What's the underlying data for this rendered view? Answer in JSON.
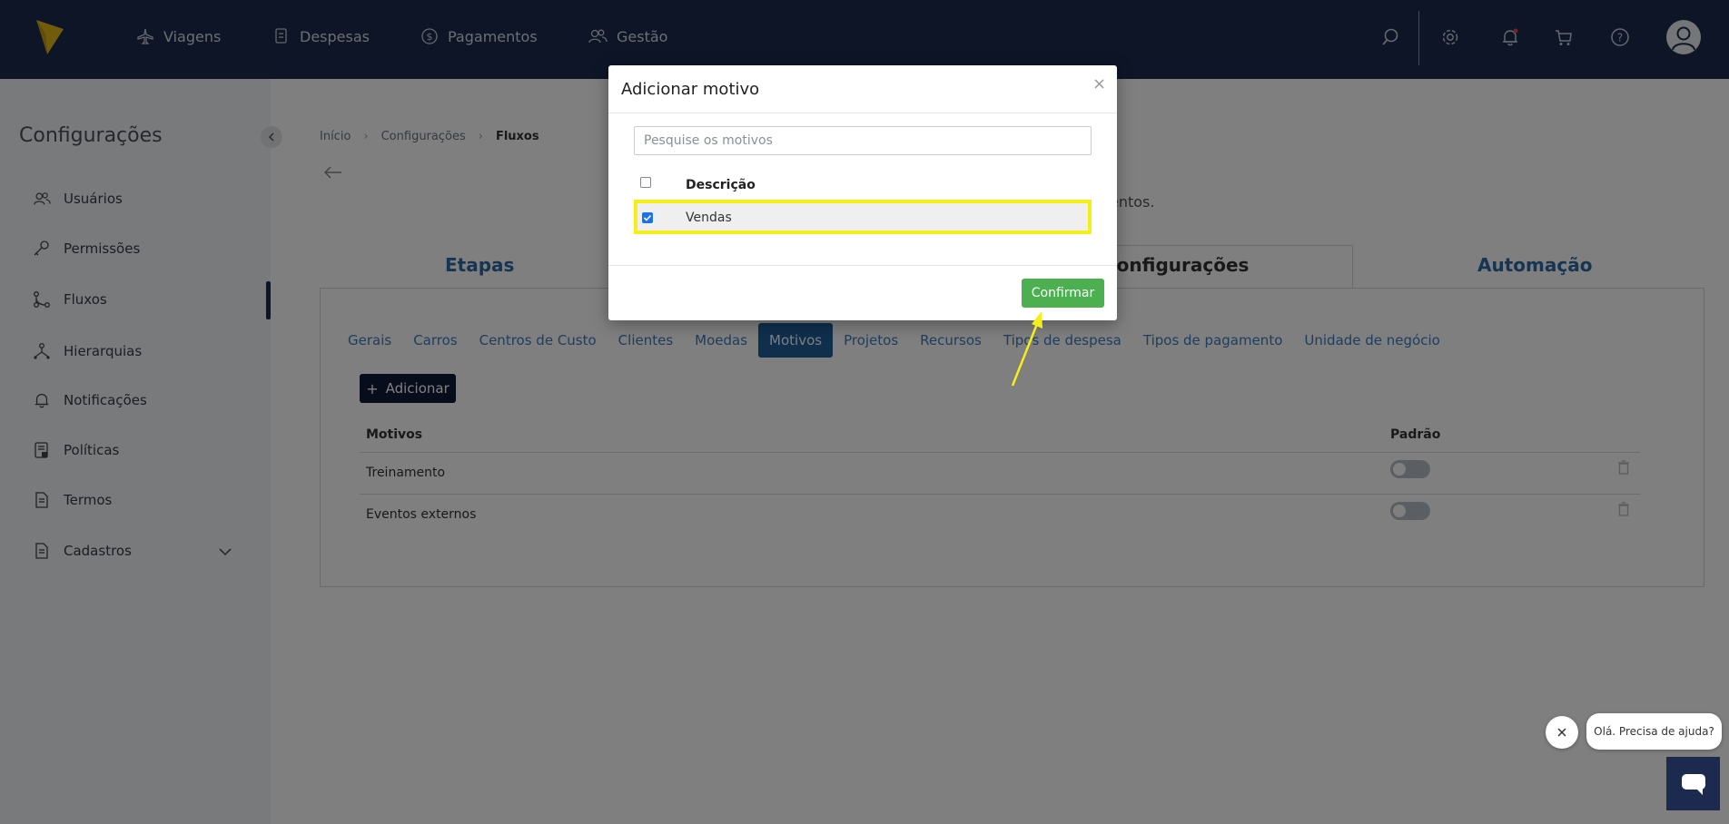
{
  "nav": {
    "items": [
      {
        "label": "Viagens",
        "icon": "plane-icon"
      },
      {
        "label": "Despesas",
        "icon": "receipt-icon"
      },
      {
        "label": "Pagamentos",
        "icon": "dollar-icon"
      },
      {
        "label": "Gestão",
        "icon": "users-icon"
      }
    ],
    "right_icons": [
      "search-icon",
      "gear-icon",
      "bell-icon",
      "cart-icon",
      "help-icon",
      "user-avatar-icon"
    ]
  },
  "sidebar": {
    "title": "Configurações",
    "items": [
      {
        "label": "Usuários",
        "icon": "users-icon"
      },
      {
        "label": "Permissões",
        "icon": "key-icon"
      },
      {
        "label": "Fluxos",
        "icon": "flow-icon"
      },
      {
        "label": "Hierarquias",
        "icon": "hierarchy-icon"
      },
      {
        "label": "Notificações",
        "icon": "bell-icon"
      },
      {
        "label": "Políticas",
        "icon": "policy-icon"
      },
      {
        "label": "Termos",
        "icon": "document-icon"
      },
      {
        "label": "Cadastros",
        "icon": "document-icon"
      }
    ]
  },
  "breadcrumb": {
    "items": [
      "Início",
      "Configurações",
      "Fluxos"
    ]
  },
  "subtitle_fragment": "entos.",
  "main_tabs": [
    "Etapas",
    "Configurações",
    "Automação"
  ],
  "sub_tabs": [
    "Gerais",
    "Carros",
    "Centros de Custo",
    "Clientes",
    "Moedas",
    "Motivos",
    "Projetos",
    "Recursos",
    "Tipos de despesa",
    "Tipos de pagamento",
    "Unidade de negócio"
  ],
  "add_button": "Adicionar",
  "table": {
    "headers": [
      "Motivos",
      "Padrão"
    ],
    "rows": [
      {
        "motivo": "Treinamento"
      },
      {
        "motivo": "Eventos externos"
      }
    ]
  },
  "modal": {
    "title": "Adicionar motivo",
    "close": "×",
    "search_placeholder": "Pesquise os motivos",
    "column_header": "Descrição",
    "rows": [
      {
        "label": "Vendas",
        "checked": true
      }
    ],
    "confirm": "Confirmar"
  },
  "chat": {
    "bubble": "Olá. Precisa de ajuda?"
  },
  "colors": {
    "navy": "#1b2a4e",
    "link_blue": "#3a7dbe",
    "active_tab": "#1f5e9a",
    "confirm_green": "#4caf50",
    "highlight_yellow": "#f5ee19"
  }
}
